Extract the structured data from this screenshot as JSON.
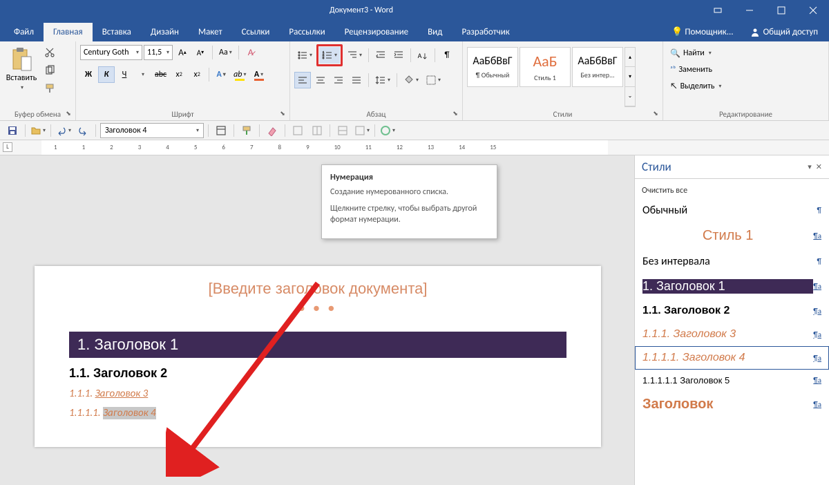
{
  "window": {
    "title": "Документ3 - Word"
  },
  "tabs": {
    "file": "Файл",
    "home": "Главная",
    "insert": "Вставка",
    "design": "Дизайн",
    "layout": "Макет",
    "references": "Ссылки",
    "mailings": "Рассылки",
    "review": "Рецензирование",
    "view": "Вид",
    "developer": "Разработчик",
    "tell_me": "Помощник...",
    "share": "Общий доступ"
  },
  "ribbon": {
    "clipboard": {
      "paste": "Вставить",
      "group": "Буфер обмена"
    },
    "font": {
      "name": "Century Goth",
      "size": "11,5",
      "group": "Шрифт",
      "bold": "Ж",
      "italic": "К",
      "underline": "Ч",
      "strike": "abc",
      "sub": "x₂",
      "sup": "x²"
    },
    "paragraph": {
      "group": "Абзац"
    },
    "styles": {
      "group": "Стили",
      "s1": {
        "sample": "АаБбВвГ",
        "name": "¶ Обычный"
      },
      "s2": {
        "sample": "АаБ",
        "name": "Стиль 1"
      },
      "s3": {
        "sample": "АаБбВвГ",
        "name": "Без интер..."
      }
    },
    "editing": {
      "group": "Редактирование",
      "find": "Найти",
      "replace": "Заменить",
      "select": "Выделить"
    }
  },
  "qat": {
    "style_dropdown": "Заголовок 4"
  },
  "tooltip": {
    "title": "Нумерация",
    "line1": "Создание нумерованного списка.",
    "line2": "Щелкните стрелку, чтобы выбрать другой формат нумерации."
  },
  "document": {
    "placeholder": "[Введите заголовок документа]",
    "h1": "1.  Заголовок 1",
    "h2": "1.1.  Заголовок 2",
    "h3_num": "1.1.1.  ",
    "h3_txt": "Заголовок 3",
    "h4_num": "1.1.1.1.  ",
    "h4_txt": "Заголовок 4"
  },
  "styles_pane": {
    "title": "Стили",
    "clear": "Очистить все",
    "items": {
      "normal": "Обычный",
      "style1": "Стиль 1",
      "nospace": "Без интервала",
      "h1": "1.  Заголовок 1",
      "h2": "1.1.  Заголовок 2",
      "h3": "1.1.1.  Заголовок 3",
      "h4": "1.1.1.1.  Заголовок 4",
      "h5": "1.1.1.1.1  Заголовок 5",
      "zag": "Заголовок"
    }
  },
  "ruler": [
    "1",
    "1",
    "2",
    "3",
    "4",
    "5",
    "6",
    "7",
    "8",
    "9",
    "10",
    "11",
    "12",
    "13",
    "14",
    "15"
  ]
}
